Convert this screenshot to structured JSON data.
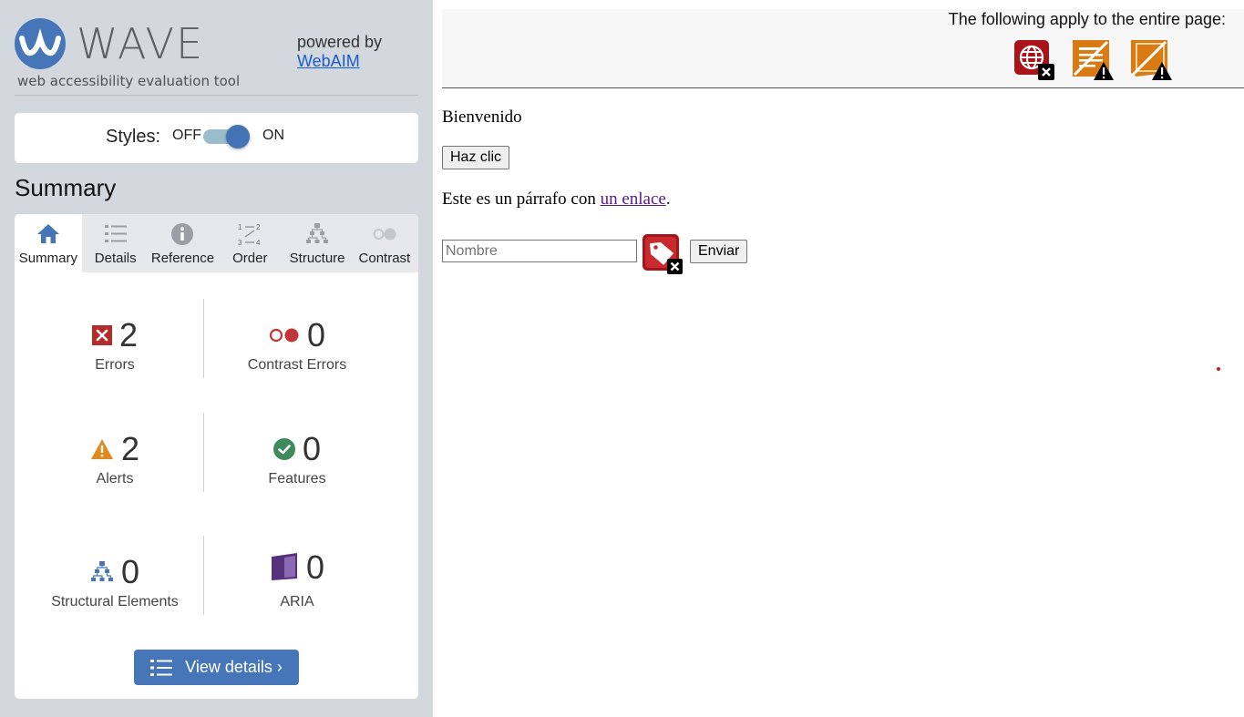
{
  "sidebar": {
    "logo": {
      "name": "WAVE",
      "tagline": "web accessibility evaluation tool"
    },
    "powered_by": {
      "text": "powered by",
      "link": "WebAIM"
    },
    "styles_toggle": {
      "label": "Styles:",
      "off": "OFF",
      "on": "ON",
      "state": "on"
    },
    "summary_heading": "Summary",
    "tabs": [
      {
        "label": "Summary",
        "icon": "home-icon",
        "active": true
      },
      {
        "label": "Details",
        "icon": "list-icon",
        "active": false
      },
      {
        "label": "Reference",
        "icon": "info-icon",
        "active": false
      },
      {
        "label": "Order",
        "icon": "order-icon",
        "active": false
      },
      {
        "label": "Structure",
        "icon": "structure-icon",
        "active": false
      },
      {
        "label": "Contrast",
        "icon": "contrast-icon",
        "active": false
      }
    ],
    "stats": {
      "errors": {
        "count": "2",
        "label": "Errors",
        "icon": "error-icon"
      },
      "contrast_errors": {
        "count": "0",
        "label": "Contrast Errors",
        "icon": "contrast-error-icon"
      },
      "alerts": {
        "count": "2",
        "label": "Alerts",
        "icon": "alert-icon"
      },
      "features": {
        "count": "0",
        "label": "Features",
        "icon": "feature-icon"
      },
      "structural": {
        "count": "0",
        "label": "Structural Elements",
        "icon": "structure-icon"
      },
      "aria": {
        "count": "0",
        "label": "ARIA",
        "icon": "aria-icon"
      }
    },
    "view_details": "View details ›"
  },
  "content": {
    "banner_text": "The following apply to the entire page:",
    "banner_icons": [
      "language-error-icon",
      "no-heading-alert-icon",
      "no-region-alert-icon"
    ],
    "welcome": "Bienvenido",
    "button": "Haz clic",
    "paragraph": {
      "before": "Este es un párrafo con ",
      "link": "un enlace",
      "after": "."
    },
    "input": {
      "placeholder": "Nombre",
      "value": ""
    },
    "input_error_icon": "missing-label-error-icon",
    "submit": "Enviar"
  },
  "colors": {
    "sidebar_bg": "#d3d8df",
    "accent_blue": "#4676b7",
    "error_red": "#b52a2a",
    "alert_orange": "#e08a1e",
    "feature_green": "#3d8a5a",
    "aria_purple": "#56327d"
  }
}
